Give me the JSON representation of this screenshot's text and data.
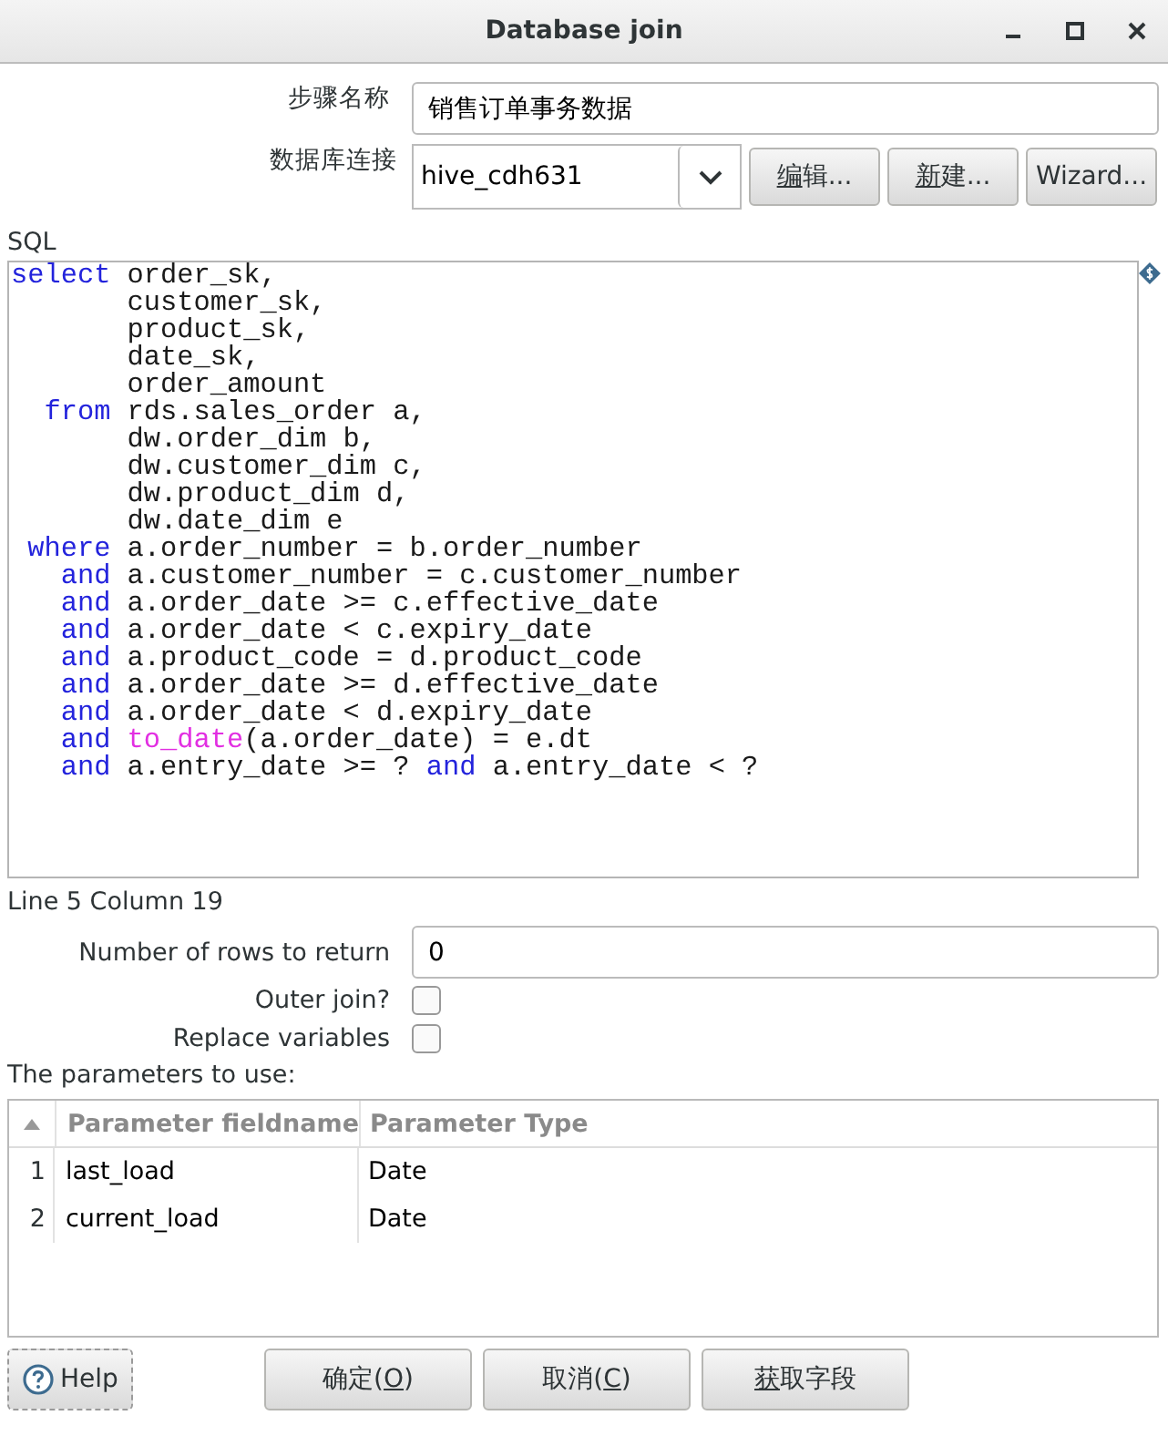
{
  "window": {
    "title": "Database join"
  },
  "step_name": {
    "label": "步骤名称",
    "value": "销售订单事务数据"
  },
  "connection": {
    "label": "数据库连接",
    "value": "hive_cdh631",
    "buttons": [
      {
        "mnemonic": "编",
        "after": "辑..."
      },
      {
        "mnemonic": "新",
        "after": "建..."
      },
      {
        "before": "Wizard..."
      }
    ]
  },
  "sql": {
    "label": "SQL",
    "lines": [
      [
        {
          "kind": "keyword",
          "text": "select"
        },
        {
          "kind": "plain",
          "text": " order_sk,"
        }
      ],
      [
        {
          "kind": "plain",
          "text": "       customer_sk,"
        }
      ],
      [
        {
          "kind": "plain",
          "text": "       product_sk,"
        }
      ],
      [
        {
          "kind": "plain",
          "text": "       date_sk,"
        }
      ],
      [
        {
          "kind": "plain",
          "text": "       order_amount"
        }
      ],
      [
        {
          "kind": "keyword",
          "text": "  from"
        },
        {
          "kind": "plain",
          "text": " rds.sales_order a,"
        }
      ],
      [
        {
          "kind": "plain",
          "text": "       dw.order_dim b,"
        }
      ],
      [
        {
          "kind": "plain",
          "text": "       dw.customer_dim c,"
        }
      ],
      [
        {
          "kind": "plain",
          "text": "       dw.product_dim d,"
        }
      ],
      [
        {
          "kind": "plain",
          "text": "       dw.date_dim e"
        }
      ],
      [
        {
          "kind": "keyword",
          "text": " where"
        },
        {
          "kind": "plain",
          "text": " a.order_number = b.order_number"
        }
      ],
      [
        {
          "kind": "keyword",
          "text": "   and"
        },
        {
          "kind": "plain",
          "text": " a.customer_number = c.customer_number"
        }
      ],
      [
        {
          "kind": "keyword",
          "text": "   and"
        },
        {
          "kind": "plain",
          "text": " a.order_date >= c.effective_date"
        }
      ],
      [
        {
          "kind": "keyword",
          "text": "   and"
        },
        {
          "kind": "plain",
          "text": " a.order_date < c.expiry_date"
        }
      ],
      [
        {
          "kind": "keyword",
          "text": "   and"
        },
        {
          "kind": "plain",
          "text": " a.product_code = d.product_code"
        }
      ],
      [
        {
          "kind": "keyword",
          "text": "   and"
        },
        {
          "kind": "plain",
          "text": " a.order_date >= d.effective_date"
        }
      ],
      [
        {
          "kind": "keyword",
          "text": "   and"
        },
        {
          "kind": "plain",
          "text": " a.order_date < d.expiry_date"
        }
      ],
      [
        {
          "kind": "keyword",
          "text": "   and"
        },
        {
          "kind": "function",
          "text": " to_date"
        },
        {
          "kind": "plain",
          "text": "(a.order_date) = e.dt"
        }
      ],
      [
        {
          "kind": "keyword",
          "text": "   and"
        },
        {
          "kind": "plain",
          "text": " a.entry_date >= ?"
        },
        {
          "kind": "keyword",
          "text": " and"
        },
        {
          "kind": "plain",
          "text": " a.entry_date < ?"
        }
      ]
    ]
  },
  "cursor_position": "Line 5 Column 19",
  "rows_to_return": {
    "label": "Number of rows to return",
    "value": "0"
  },
  "options": [
    {
      "label": "Outer join?",
      "checked": false
    },
    {
      "label": "Replace variables",
      "checked": false
    }
  ],
  "parameters": {
    "label": "The parameters to use:",
    "columns": [
      "Parameter fieldname",
      "Parameter Type"
    ],
    "rows": [
      {
        "index": "1",
        "fieldname": "last_load",
        "type": "Date"
      },
      {
        "index": "2",
        "fieldname": "current_load",
        "type": "Date"
      }
    ]
  },
  "help_button": "Help",
  "buttons": [
    {
      "before": "确定(",
      "mnemonic": "O",
      "after": ")"
    },
    {
      "before": "取消(",
      "mnemonic": "C",
      "after": ")"
    },
    {
      "mnemonic": "获",
      "after": "取字段"
    }
  ]
}
